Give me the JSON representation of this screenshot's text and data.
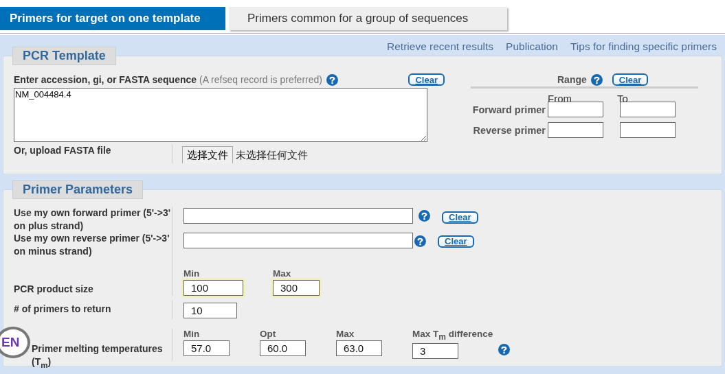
{
  "tabs": [
    {
      "label": "Primers for target on one template",
      "selected": true
    },
    {
      "label": "Primers common for a group of sequences",
      "selected": false
    }
  ],
  "links": [
    "Retrieve recent results",
    "Publication",
    "Tips for finding specific primers"
  ],
  "pcr_template": {
    "legend": "PCR Template",
    "sequence_label": "Enter accession, gi, or FASTA sequence",
    "sequence_hint": "(A refseq record is preferred)",
    "sequence_value": "NM_004484.4",
    "clear_button": "Clear",
    "upload_label": "Or, upload FASTA file",
    "file_button": "选择文件",
    "file_status": "未选择任何文件",
    "range": {
      "label": "Range",
      "clear_button": "Clear",
      "from_label": "From",
      "to_label": "To",
      "rows": [
        {
          "label": "Forward primer"
        },
        {
          "label": "Reverse primer"
        }
      ]
    }
  },
  "primer_parameters": {
    "legend": "Primer Parameters",
    "own_primers": [
      {
        "label": "Use my own forward primer (5'->3' on plus strand)",
        "clear_button": "Clear"
      },
      {
        "label": "Use my own reverse primer (5'->3' on minus strand)",
        "clear_button": "Clear"
      }
    ],
    "product_size": {
      "label": "PCR product size",
      "fields": [
        {
          "caption": "Min",
          "value": "100",
          "highlighted": true
        },
        {
          "caption": "Max",
          "value": "300",
          "highlighted": true
        }
      ]
    },
    "primers_to_return": {
      "label": "# of primers to return",
      "value": "10"
    },
    "melting": {
      "label": "Primer melting temperatures (T$_{m}$)",
      "fields": [
        {
          "caption": "Min",
          "value": "57.0"
        },
        {
          "caption": "Opt",
          "value": "60.0"
        },
        {
          "caption": "Max",
          "value": "63.0"
        },
        {
          "caption": "Max T$_{m}$ difference",
          "value": "3"
        }
      ]
    }
  },
  "language_badge": "EN"
}
